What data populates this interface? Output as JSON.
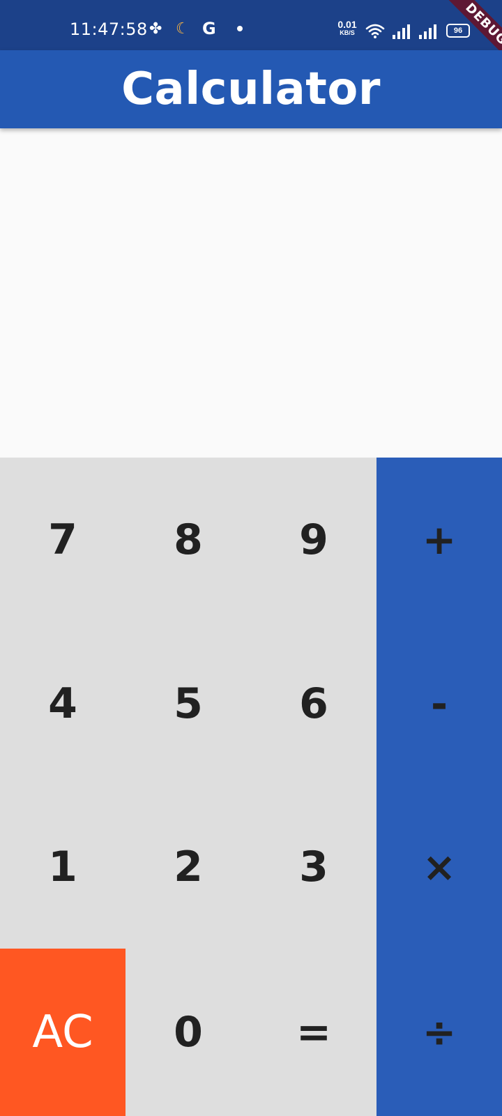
{
  "status_bar": {
    "time": "11:47:58",
    "icons_left": [
      "fan-icon",
      "moon-icon",
      "google-icon",
      "notification-dot-icon"
    ],
    "google_glyph": "G",
    "net_speed_value": "0.01",
    "net_speed_unit": "KB/S",
    "battery_level": "96",
    "icons_right": [
      "wifi-icon",
      "signal-icon",
      "signal-icon",
      "battery-icon"
    ]
  },
  "debug_banner": "DEBUG",
  "app_bar": {
    "title": "Calculator",
    "color": "#2459b3"
  },
  "display": {
    "expression": "",
    "result": ""
  },
  "keypad": {
    "k7": "7",
    "k8": "8",
    "k9": "9",
    "kplus": "+",
    "k4": "4",
    "k5": "5",
    "k6": "6",
    "kminus": "-",
    "k1": "1",
    "k2": "2",
    "k3": "3",
    "kmul": "×",
    "kac": "AC",
    "k0": "0",
    "keq": "=",
    "kdiv": "÷"
  },
  "colors": {
    "keypad_bg": "#dedede",
    "operator_bg": "#2a5db8",
    "clear_bg": "#ff5722",
    "status_bar_bg": "#1c4189"
  }
}
